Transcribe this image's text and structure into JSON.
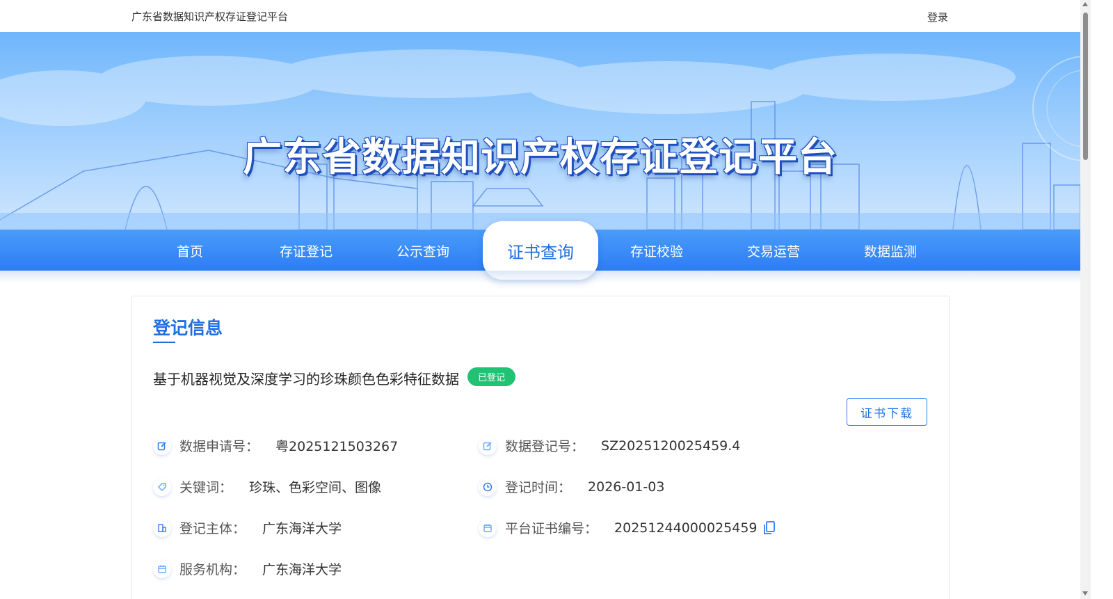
{
  "topbar": {
    "site_name": "广东省数据知识产权存证登记平台",
    "login": "登录"
  },
  "banner": {
    "title": "广东省数据知识产权存证登记平台"
  },
  "nav": {
    "items": [
      "首页",
      "存证登记",
      "公示查询",
      "证书查询",
      "存证校验",
      "交易运营",
      "数据监测"
    ],
    "active": "证书查询"
  },
  "record": {
    "heading": "登记信息",
    "title": "基于机器视觉及深度学习的珍珠颜色色彩特征数据",
    "status": "已登记",
    "download_button": "证书下载",
    "fields": {
      "application_no_label": "数据申请号：",
      "application_no": "粤2025121503267",
      "registration_no_label": "数据登记号：",
      "registration_no": "SZ2025120025459.4",
      "keywords_label": "关键词：",
      "keywords": "珍珠、色彩空间、图像",
      "reg_time_label": "登记时间：",
      "reg_time": "2026-01-03",
      "subject_label": "登记主体：",
      "subject": "广东海洋大学",
      "cert_no_label": "平台证书编号：",
      "cert_no": "20251244000025459",
      "agency_label": "服务机构：",
      "agency": "广东海洋大学"
    }
  },
  "colors": {
    "primary": "#1f6fe0",
    "nav": "#2d7df4",
    "badge": "#22c274"
  },
  "icons": [
    "edit-icon",
    "tag-icon",
    "clock-icon",
    "building-icon",
    "calendar-icon",
    "copy-icon"
  ]
}
